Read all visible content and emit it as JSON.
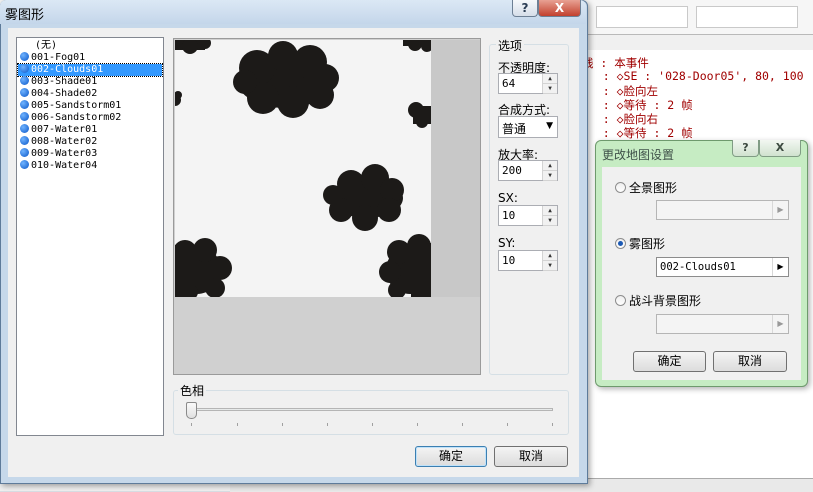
{
  "background_editor": {
    "lines": [
      "线 : 本事件",
      "   : ◇SE : '028-Door05', 80, 100",
      "   : ◇脸向左",
      "   : ◇等待 : 2 帧",
      "   : ◇脸向右",
      "   : ◇等待 : 2 帧"
    ]
  },
  "fog_dialog": {
    "title": "雾图形",
    "help": "?",
    "close": "X",
    "list": [
      "(无)",
      "001-Fog01",
      "002-Clouds01",
      "003-Shade01",
      "004-Shade02",
      "005-Sandstorm01",
      "006-Sandstorm02",
      "007-Water01",
      "008-Water02",
      "009-Water03",
      "010-Water04"
    ],
    "selected_index": 2,
    "options": {
      "group_label": "选项",
      "opacity_label": "不透明度:",
      "opacity_value": "64",
      "blend_label": "合成方式:",
      "blend_value": "普通",
      "zoom_label": "放大率:",
      "zoom_value": "200",
      "sx_label": "SX:",
      "sx_value": "10",
      "sy_label": "SY:",
      "sy_value": "10"
    },
    "hue": {
      "label": "色相",
      "value": 0
    },
    "ok": "确定",
    "cancel": "取消"
  },
  "map_dialog": {
    "title": "更改地图设置",
    "help": "?",
    "close": "X",
    "panorama_label": "全景图形",
    "panorama_value": "",
    "fog_label": "雾图形",
    "fog_value": "002-Clouds01",
    "battleback_label": "战斗背景图形",
    "battleback_value": "",
    "selected": "fog",
    "ok": "确定",
    "cancel": "取消"
  },
  "colors": {
    "selection": "#3399ff",
    "fog_titlebar": "#c6d8ea",
    "map_dialog_frame": "#c6ecc3",
    "code_text": "#a00000",
    "cloud": "#1c1a18"
  }
}
